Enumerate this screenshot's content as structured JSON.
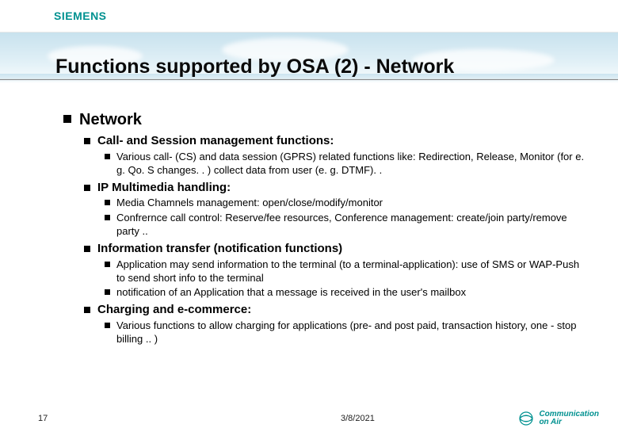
{
  "brand": "SIEMENS",
  "title": "Functions supported by OSA   (2) - Network",
  "section": "Network",
  "items": [
    {
      "heading": "Call- and Session management functions:",
      "subs": [
        "Various call- (CS) and data session (GPRS) related functions like: Redirection, Release, Monitor (for e. g. Qo. S changes. . ) collect data from user (e. g. DTMF). ."
      ]
    },
    {
      "heading": "IP Multimedia handling:",
      "subs": [
        "Media Chamnels management: open/close/modify/monitor",
        "Confrernce  call control: Reserve/fee resources, Conference management: create/join party/remove party .."
      ]
    },
    {
      "heading": "Information transfer (notification functions)",
      "subs": [
        "Application may send information to the terminal (to a terminal-application): use of SMS or WAP-Push to send short info to the terminal",
        "notification of an Application that a message is received in the user's mailbox"
      ]
    },
    {
      "heading": "Charging and e-commerce:",
      "subs": [
        "Various functions to allow charging for applications (pre- and post paid, transaction history, one - stop billing .. )"
      ]
    }
  ],
  "footer": {
    "page": "17",
    "date": "3/8/2021",
    "logo_line1": "Communication",
    "logo_line2": "on Air"
  }
}
